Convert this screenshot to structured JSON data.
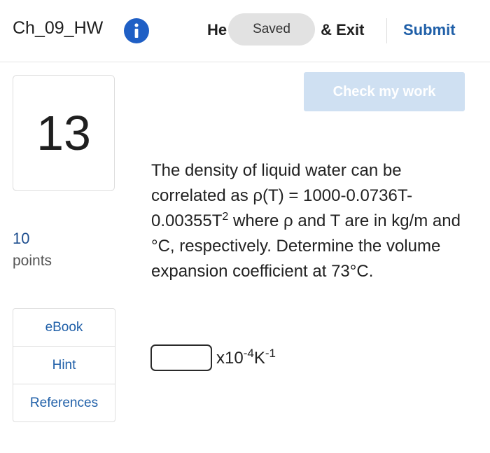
{
  "header": {
    "assignment_title": "Ch_09_HW",
    "info_icon": "info-icon",
    "save_exit_left": "He",
    "save_exit_right": "& Exit",
    "saved_toast": "Saved",
    "submit_label": "Submit"
  },
  "question": {
    "number": "13",
    "points_value": "10",
    "points_label": "points",
    "check_work_label": "Check my work",
    "text_line1": "The density of liquid water can be correlated as ρ(T) = 1000-0.0736T-0.00355T",
    "text_exp": "2",
    "text_line2": " where ρ and T are in kg/m and °C, respectively. Determine the volume expansion coefficient at 73°C."
  },
  "resources": {
    "items": [
      {
        "label": "eBook"
      },
      {
        "label": "Hint"
      },
      {
        "label": "References"
      }
    ]
  },
  "answer": {
    "value": "",
    "placeholder": "",
    "unit_base": "x10",
    "unit_exp1": "-4",
    "unit_k": "K",
    "unit_exp2": "-1"
  },
  "colors": {
    "accent": "#1f5fa8",
    "info_icon_bg": "#1f5fc5",
    "check_button_bg": "#cfe0f2",
    "toast_bg": "#e2e2e2"
  }
}
